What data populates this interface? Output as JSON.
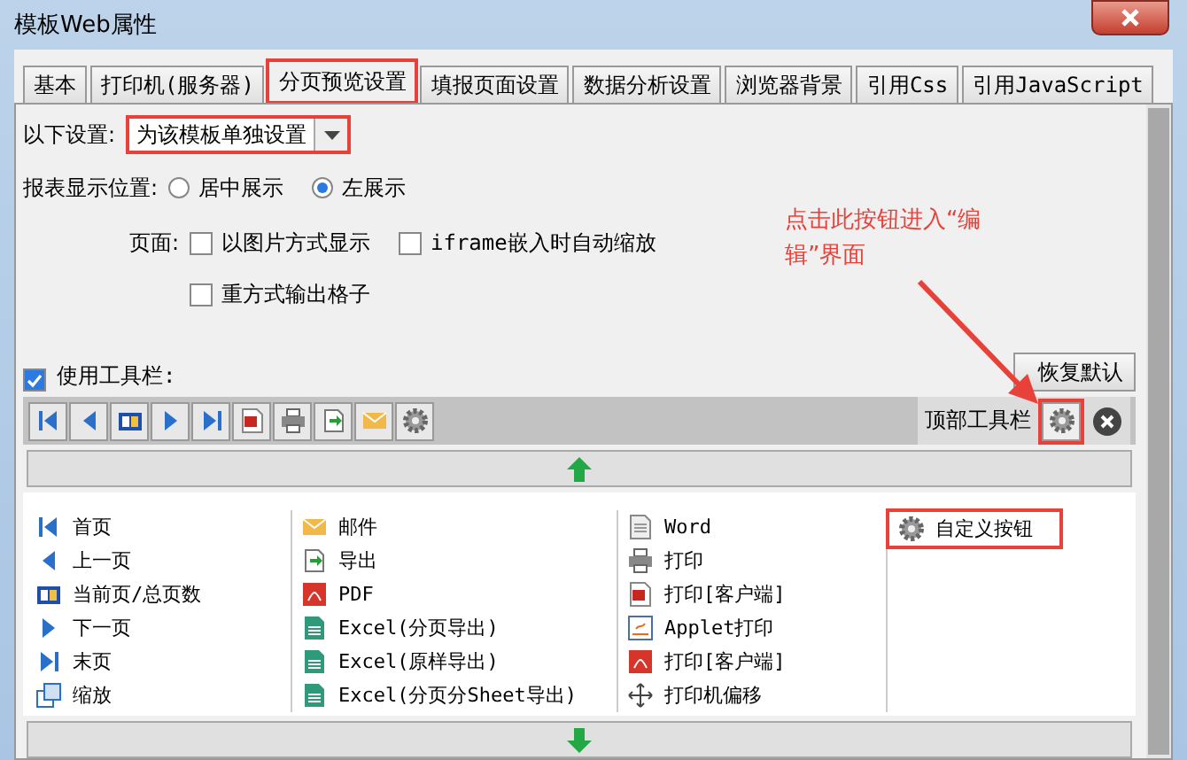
{
  "window": {
    "title": "模板Web属性"
  },
  "tabs": [
    {
      "label": "基本",
      "selected": false,
      "highlighted": false
    },
    {
      "label": "打印机(服务器)",
      "selected": false,
      "highlighted": false
    },
    {
      "label": "分页预览设置",
      "selected": true,
      "highlighted": true
    },
    {
      "label": "填报页面设置",
      "selected": false,
      "highlighted": false
    },
    {
      "label": "数据分析设置",
      "selected": false,
      "highlighted": false
    },
    {
      "label": "浏览器背景",
      "selected": false,
      "highlighted": false
    },
    {
      "label": "引用Css",
      "selected": false,
      "highlighted": false
    },
    {
      "label": "引用JavaScript",
      "selected": false,
      "highlighted": false
    }
  ],
  "settings": {
    "label": "以下设置:",
    "dropdown": {
      "value": "为该模板单独设置",
      "highlighted": true
    }
  },
  "display_position": {
    "label": "报表显示位置:",
    "options": [
      {
        "label": "居中展示",
        "selected": false
      },
      {
        "label": "左展示",
        "selected": true
      }
    ]
  },
  "page": {
    "label": "页面:",
    "options": [
      {
        "label": "以图片方式显示",
        "checked": false
      },
      {
        "label": "iframe嵌入时自动缩放",
        "checked": false
      },
      {
        "label": "重方式输出格子",
        "checked": false
      }
    ]
  },
  "use_toolbar": {
    "label": "使用工具栏:",
    "checked": true
  },
  "restore_button": "恢复默认",
  "annotation": {
    "text": "点击此按钮进入“编辑”界面"
  },
  "toolbar": {
    "buttons": [
      {
        "kind": "first"
      },
      {
        "kind": "prev"
      },
      {
        "kind": "pages"
      },
      {
        "kind": "next"
      },
      {
        "kind": "last"
      },
      {
        "kind": "flash"
      },
      {
        "kind": "print"
      },
      {
        "kind": "export"
      },
      {
        "kind": "mail"
      },
      {
        "kind": "gear"
      }
    ],
    "label": "顶部工具栏",
    "edit_highlighted": true
  },
  "button_table": {
    "columns": [
      [
        {
          "label": "首页",
          "kind": "first"
        },
        {
          "label": "上一页",
          "kind": "prev"
        },
        {
          "label": "当前页/总页数",
          "kind": "pages"
        },
        {
          "label": "下一页",
          "kind": "next"
        },
        {
          "label": "末页",
          "kind": "last"
        },
        {
          "label": "缩放",
          "kind": "zoom"
        }
      ],
      [
        {
          "label": "邮件",
          "kind": "mail"
        },
        {
          "label": "导出",
          "kind": "export"
        },
        {
          "label": "PDF",
          "kind": "pdf"
        },
        {
          "label": "Excel(分页导出)",
          "kind": "excel"
        },
        {
          "label": "Excel(原样导出)",
          "kind": "excel"
        },
        {
          "label": "Excel(分页分Sheet导出)",
          "kind": "excel"
        }
      ],
      [
        {
          "label": "Word",
          "kind": "word"
        },
        {
          "label": "打印",
          "kind": "print"
        },
        {
          "label": "打印[客户端]",
          "kind": "flash"
        },
        {
          "label": "Applet打印",
          "kind": "applet"
        },
        {
          "label": "打印[客户端]",
          "kind": "pdf"
        },
        {
          "label": "打印机偏移",
          "kind": "offset"
        }
      ],
      [
        {
          "label": "自定义按钮",
          "kind": "gear",
          "highlighted": true
        }
      ]
    ]
  }
}
